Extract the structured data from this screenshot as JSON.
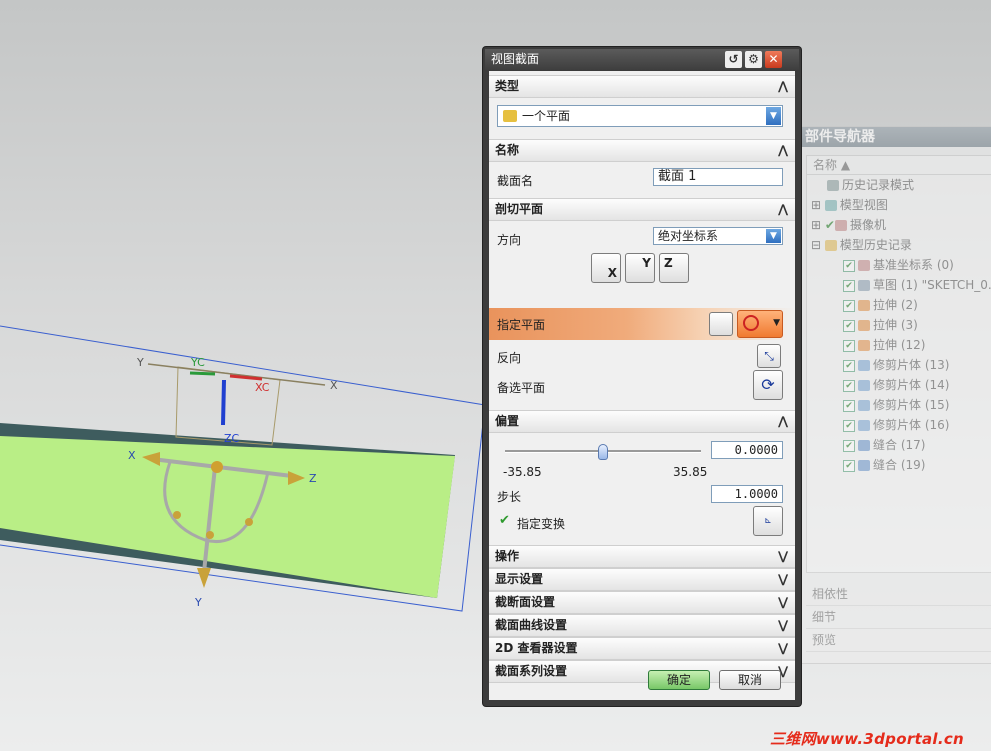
{
  "viewport": {
    "axes": {
      "x": "X",
      "y": "Y",
      "z": "Z",
      "xc": "XC",
      "yc": "YC",
      "zc": "ZC",
      "small_y": "Y",
      "small_x": "X"
    },
    "plane_color": "#b9ee86"
  },
  "navigator": {
    "title": "部件导航器",
    "column": "名称",
    "items": [
      {
        "label": "历史记录模式"
      },
      {
        "label": "模型视图"
      },
      {
        "label": "摄像机"
      },
      {
        "label": "模型历史记录"
      },
      {
        "label": "基准坐标系 (0)"
      },
      {
        "label": "草图 (1) \"SKETCH_0..."
      },
      {
        "label": "拉伸 (2)"
      },
      {
        "label": "拉伸 (3)"
      },
      {
        "label": "拉伸 (12)"
      },
      {
        "label": "修剪片体 (13)"
      },
      {
        "label": "修剪片体 (14)"
      },
      {
        "label": "修剪片体 (15)"
      },
      {
        "label": "修剪片体 (16)"
      },
      {
        "label": "缝合 (17)"
      },
      {
        "label": "缝合 (19)"
      }
    ],
    "bottom": [
      "相依性",
      "细节",
      "预览"
    ]
  },
  "dialog": {
    "title": "视图截面",
    "type_group": {
      "label": "类型",
      "value": "一个平面"
    },
    "name_group": {
      "label": "名称",
      "field_label": "截面名",
      "value": "截面 1"
    },
    "plane_group": {
      "label": "剖切平面",
      "direction_label": "方向",
      "direction_value": "绝对坐标系",
      "axis_buttons": [
        "X",
        "Y",
        "Z"
      ],
      "specify_plane": "指定平面",
      "reverse": "反向",
      "alternate": "备选平面"
    },
    "offset_group": {
      "label": "偏置",
      "value": "0.0000",
      "min": "-35.85",
      "max": "35.85",
      "slider_position": 0.5,
      "step_label": "步长",
      "step_value": "1.0000",
      "transform_label": "指定变换"
    },
    "collapsed_groups": [
      "操作",
      "显示设置",
      "截断面设置",
      "截面曲线设置",
      "2D 查看器设置",
      "截面系列设置"
    ],
    "ok": "确定",
    "cancel": "取消"
  },
  "watermark": "三维网www.3dportal.cn"
}
